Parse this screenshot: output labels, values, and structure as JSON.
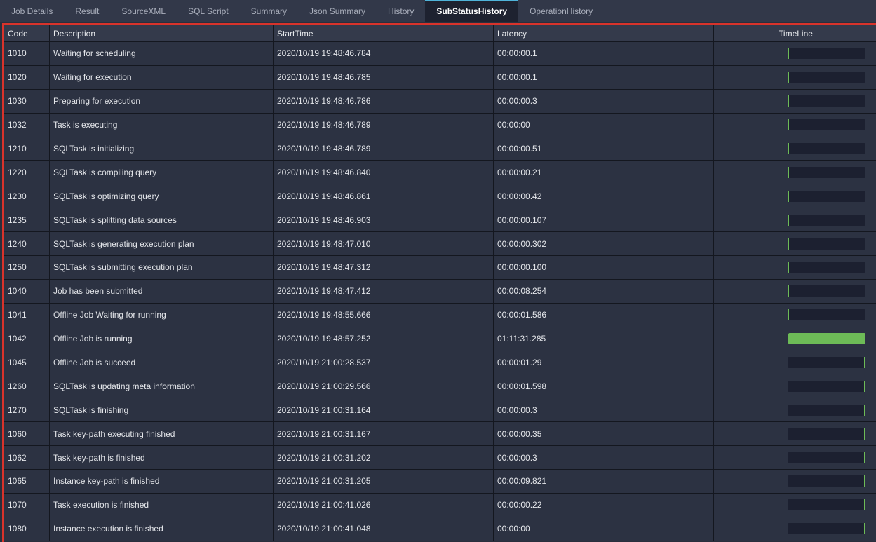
{
  "tabs": [
    "Job Details",
    "Result",
    "SourceXML",
    "SQL Script",
    "Summary",
    "Json Summary",
    "History",
    "SubStatusHistory",
    "OperationHistory"
  ],
  "active_tab": "SubStatusHistory",
  "columns": [
    "Code",
    "Description",
    "StartTime",
    "Latency",
    "TimeLine"
  ],
  "colors": {
    "accent": "#4fb3d9",
    "timeline": "#6dbb57",
    "highlight_border": "#d9332b"
  },
  "rows": [
    {
      "code": "1010",
      "desc": "Waiting for scheduling",
      "start": "2020/10/19 19:48:46.784",
      "latency": "00:00:00.1",
      "tl_offset": 0,
      "tl_width": 0
    },
    {
      "code": "1020",
      "desc": "Waiting for execution",
      "start": "2020/10/19 19:48:46.785",
      "latency": "00:00:00.1",
      "tl_offset": 0,
      "tl_width": 0
    },
    {
      "code": "1030",
      "desc": "Preparing for execution",
      "start": "2020/10/19 19:48:46.786",
      "latency": "00:00:00.3",
      "tl_offset": 0,
      "tl_width": 0
    },
    {
      "code": "1032",
      "desc": "Task is executing",
      "start": "2020/10/19 19:48:46.789",
      "latency": "00:00:00",
      "tl_offset": 0,
      "tl_width": 0
    },
    {
      "code": "1210",
      "desc": "SQLTask is initializing",
      "start": "2020/10/19 19:48:46.789",
      "latency": "00:00:00.51",
      "tl_offset": 0,
      "tl_width": 0
    },
    {
      "code": "1220",
      "desc": "SQLTask is compiling query",
      "start": "2020/10/19 19:48:46.840",
      "latency": "00:00:00.21",
      "tl_offset": 0,
      "tl_width": 0
    },
    {
      "code": "1230",
      "desc": "SQLTask is optimizing query",
      "start": "2020/10/19 19:48:46.861",
      "latency": "00:00:00.42",
      "tl_offset": 0,
      "tl_width": 0
    },
    {
      "code": "1235",
      "desc": "SQLTask is splitting data sources",
      "start": "2020/10/19 19:48:46.903",
      "latency": "00:00:00.107",
      "tl_offset": 0,
      "tl_width": 0
    },
    {
      "code": "1240",
      "desc": "SQLTask is generating execution plan",
      "start": "2020/10/19 19:48:47.010",
      "latency": "00:00:00.302",
      "tl_offset": 0,
      "tl_width": 0
    },
    {
      "code": "1250",
      "desc": "SQLTask is submitting execution plan",
      "start": "2020/10/19 19:48:47.312",
      "latency": "00:00:00.100",
      "tl_offset": 0,
      "tl_width": 0
    },
    {
      "code": "1040",
      "desc": "Job has been submitted",
      "start": "2020/10/19 19:48:47.412",
      "latency": "00:00:08.254",
      "tl_offset": 0.002,
      "tl_width": 0.002
    },
    {
      "code": "1041",
      "desc": "Offline Job Waiting for running",
      "start": "2020/10/19 19:48:55.666",
      "latency": "00:00:01.586",
      "tl_offset": 0.004,
      "tl_width": 0
    },
    {
      "code": "1042",
      "desc": "Offline Job is running",
      "start": "2020/10/19 19:48:57.252",
      "latency": "01:11:31.285",
      "tl_offset": 0.005,
      "tl_width": 0.993
    },
    {
      "code": "1045",
      "desc": "Offline Job is succeed",
      "start": "2020/10/19 21:00:28.537",
      "latency": "00:00:01.29",
      "tl_offset": 1,
      "tl_width": 0
    },
    {
      "code": "1260",
      "desc": "SQLTask is updating meta information",
      "start": "2020/10/19 21:00:29.566",
      "latency": "00:00:01.598",
      "tl_offset": 1,
      "tl_width": 0
    },
    {
      "code": "1270",
      "desc": "SQLTask is finishing",
      "start": "2020/10/19 21:00:31.164",
      "latency": "00:00:00.3",
      "tl_offset": 1,
      "tl_width": 0
    },
    {
      "code": "1060",
      "desc": "Task key-path executing finished",
      "start": "2020/10/19 21:00:31.167",
      "latency": "00:00:00.35",
      "tl_offset": 1,
      "tl_width": 0
    },
    {
      "code": "1062",
      "desc": "Task key-path is finished",
      "start": "2020/10/19 21:00:31.202",
      "latency": "00:00:00.3",
      "tl_offset": 1,
      "tl_width": 0
    },
    {
      "code": "1065",
      "desc": "Instance key-path is finished",
      "start": "2020/10/19 21:00:31.205",
      "latency": "00:00:09.821",
      "tl_offset": 1,
      "tl_width": 0
    },
    {
      "code": "1070",
      "desc": "Task execution is finished",
      "start": "2020/10/19 21:00:41.026",
      "latency": "00:00:00.22",
      "tl_offset": 1,
      "tl_width": 0
    },
    {
      "code": "1080",
      "desc": "Instance execution is finished",
      "start": "2020/10/19 21:00:41.048",
      "latency": "00:00:00",
      "tl_offset": 1,
      "tl_width": 0
    }
  ]
}
